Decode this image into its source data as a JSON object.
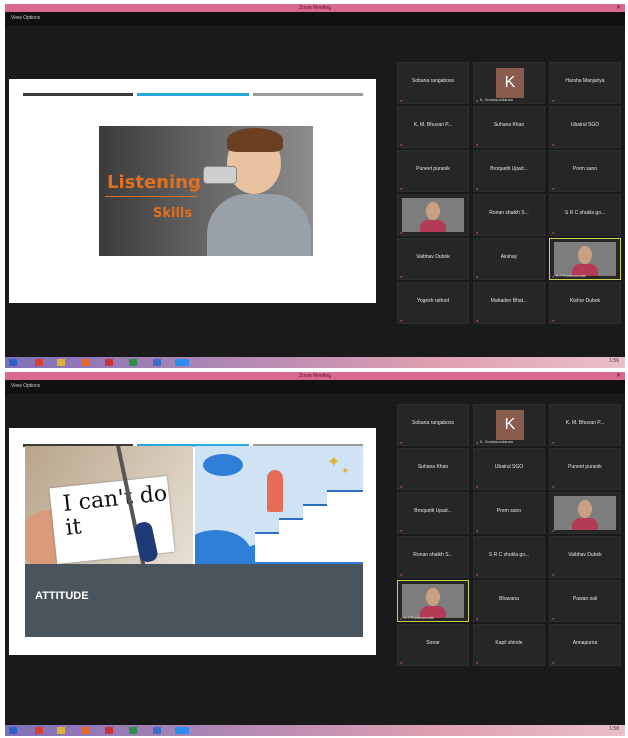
{
  "screens": [
    {
      "window_title": "Zoom Meeting",
      "view_options": "View Options",
      "slide": {
        "title_line1": "Listening",
        "title_line2": "Skills"
      },
      "participants": [
        {
          "name": "Sobana rangaboss"
        },
        {
          "name": "",
          "avatar": "K",
          "caption": "K. Somasundaram"
        },
        {
          "name": "Harsha Manjariya"
        },
        {
          "name": "K. M. Bhuvan P..."
        },
        {
          "name": "Suhana Khan"
        },
        {
          "name": "Ubairul SGO"
        },
        {
          "name": "Puneet puranik"
        },
        {
          "name": "Broquetti Upad..."
        },
        {
          "name": "Prem sano"
        },
        {
          "name": "",
          "video": true,
          "caption": ""
        },
        {
          "name": "Ronan shaikh S..."
        },
        {
          "name": "S R C shukla go..."
        },
        {
          "name": "Vaibhav Dubok"
        },
        {
          "name": "Akshay"
        },
        {
          "name": "",
          "video": true,
          "caption": "K.T.Parshwanath"
        },
        {
          "name": "Yogesh rathod"
        },
        {
          "name": "Mahadev Bhat..."
        },
        {
          "name": "Kishor Dubok"
        }
      ],
      "clock": "1:56"
    },
    {
      "window_title": "Zoom Meeting",
      "view_options": "View Options",
      "slide": {
        "card_text": "I can't do it",
        "bar_label": "ATTITUDE"
      },
      "participants": [
        {
          "name": "Sobana rangaboss"
        },
        {
          "name": "",
          "avatar": "K",
          "caption": "K. Somasundaram"
        },
        {
          "name": "K. M. Bhuvan P..."
        },
        {
          "name": "Suhana Khan"
        },
        {
          "name": "Ubairul SGO"
        },
        {
          "name": "Puneet puranik"
        },
        {
          "name": "Broquetti Upad..."
        },
        {
          "name": "Prem sano"
        },
        {
          "name": "",
          "video": true,
          "caption": ""
        },
        {
          "name": "Ronan shaikh S..."
        },
        {
          "name": "S R C shukla go..."
        },
        {
          "name": "Vaibhav Dubok"
        },
        {
          "name": "",
          "video": true,
          "caption": "K.T.Parshwanath"
        },
        {
          "name": "Bhavana"
        },
        {
          "name": "Pawan sali"
        },
        {
          "name": "Sonar"
        },
        {
          "name": "Kapil shinde"
        },
        {
          "name": "Annapurna"
        }
      ],
      "clock": "1:58"
    }
  ]
}
